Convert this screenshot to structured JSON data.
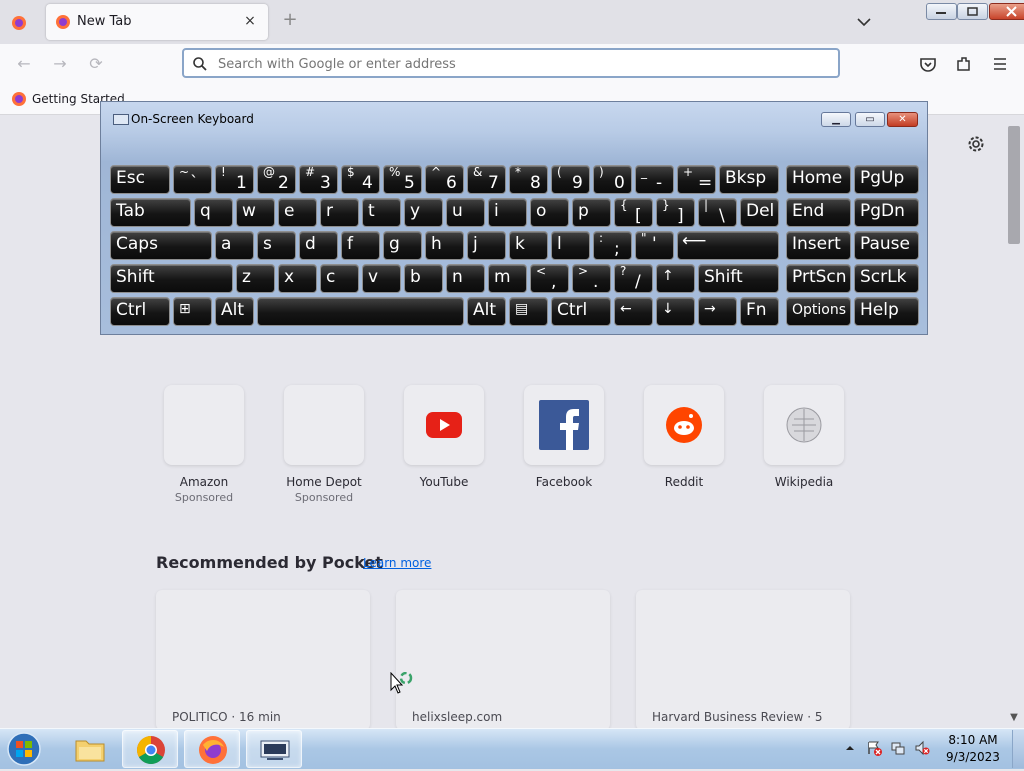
{
  "browser": {
    "tab_title": "New Tab",
    "tab_close_glyph": "×",
    "new_tab_glyph": "+",
    "address_placeholder": "Search with Google or enter address",
    "bookmark": "Getting Started"
  },
  "nav": {
    "back": "←",
    "forward": "→",
    "reload": "⟳"
  },
  "osk": {
    "title": "On-Screen Keyboard",
    "minimize": "▭",
    "restore": "▭",
    "close": "✕"
  },
  "keys": {
    "esc": "Esc",
    "tilde_top": "~",
    "tilde_bot": "`",
    "n1_top": "!",
    "n1": "1",
    "n2_top": "@",
    "n2": "2",
    "n3_top": "#",
    "n3": "3",
    "n4_top": "$",
    "n4": "4",
    "n5_top": "%",
    "n5": "5",
    "n6_top": "^",
    "n6": "6",
    "n7_top": "&",
    "n7": "7",
    "n8_top": "*",
    "n8": "8",
    "n9_top": "(",
    "n9": "9",
    "n0_top": ")",
    "n0": "0",
    "minus_top": "_",
    "minus": "-",
    "plus_top": "+",
    "equals": "=",
    "bksp": "Bksp",
    "home": "Home",
    "pgup": "PgUp",
    "tab": "Tab",
    "q": "q",
    "w": "w",
    "e": "e",
    "r": "r",
    "t": "t",
    "y": "y",
    "u": "u",
    "i": "i",
    "o": "o",
    "p": "p",
    "lbr_top": "{",
    "lbr": "[",
    "rbr_top": "}",
    "rbr": "]",
    "bsl_top": "|",
    "bsl": "\\",
    "del": "Del",
    "end": "End",
    "pgdn": "PgDn",
    "caps": "Caps",
    "a": "a",
    "s": "s",
    "d": "d",
    "f": "f",
    "g": "g",
    "h": "h",
    "j": "j",
    "k": "k",
    "l": "l",
    "semi_top": ":",
    "semi": ";",
    "quote_top": "\"",
    "quote": "'",
    "enter": "⟵",
    "insert": "Insert",
    "pause": "Pause",
    "shift": "Shift",
    "z": "z",
    "x": "x",
    "c": "c",
    "v": "v",
    "b": "b",
    "n": "n",
    "m": "m",
    "comma_top": "<",
    "comma": ",",
    "period_top": ">",
    "period": ".",
    "slash_top": "?",
    "slash": "/",
    "up": "↑",
    "shift_r": "Shift",
    "prtscn": "PrtScn",
    "scrlk": "ScrLk",
    "ctrl": "Ctrl",
    "win": "⊞",
    "alt": "Alt",
    "alt_r": "Alt",
    "menu": "▤",
    "ctrl_r": "Ctrl",
    "left": "←",
    "down": "↓",
    "right": "→",
    "fn": "Fn",
    "options": "Options",
    "help": "Help"
  },
  "top_sites": [
    {
      "name": "Amazon",
      "sub": "Sponsored"
    },
    {
      "name": "Home Depot",
      "sub": "Sponsored"
    },
    {
      "name": "YouTube",
      "sub": ""
    },
    {
      "name": "Facebook",
      "sub": ""
    },
    {
      "name": "Reddit",
      "sub": ""
    },
    {
      "name": "Wikipedia",
      "sub": ""
    }
  ],
  "pocket": {
    "title": "Recommended by Pocket",
    "learn_more": "Learn more",
    "cards": [
      {
        "source": "POLITICO · 16 min"
      },
      {
        "source": "helixsleep.com"
      },
      {
        "source": "Harvard Business Review · 5"
      }
    ]
  },
  "taskbar": {
    "time": "8:10 AM",
    "date": "9/3/2023"
  },
  "colors": {
    "accent": "#0061e0",
    "youtube": "#ff0000",
    "facebook": "#3b5998",
    "reddit": "#ff4500"
  }
}
